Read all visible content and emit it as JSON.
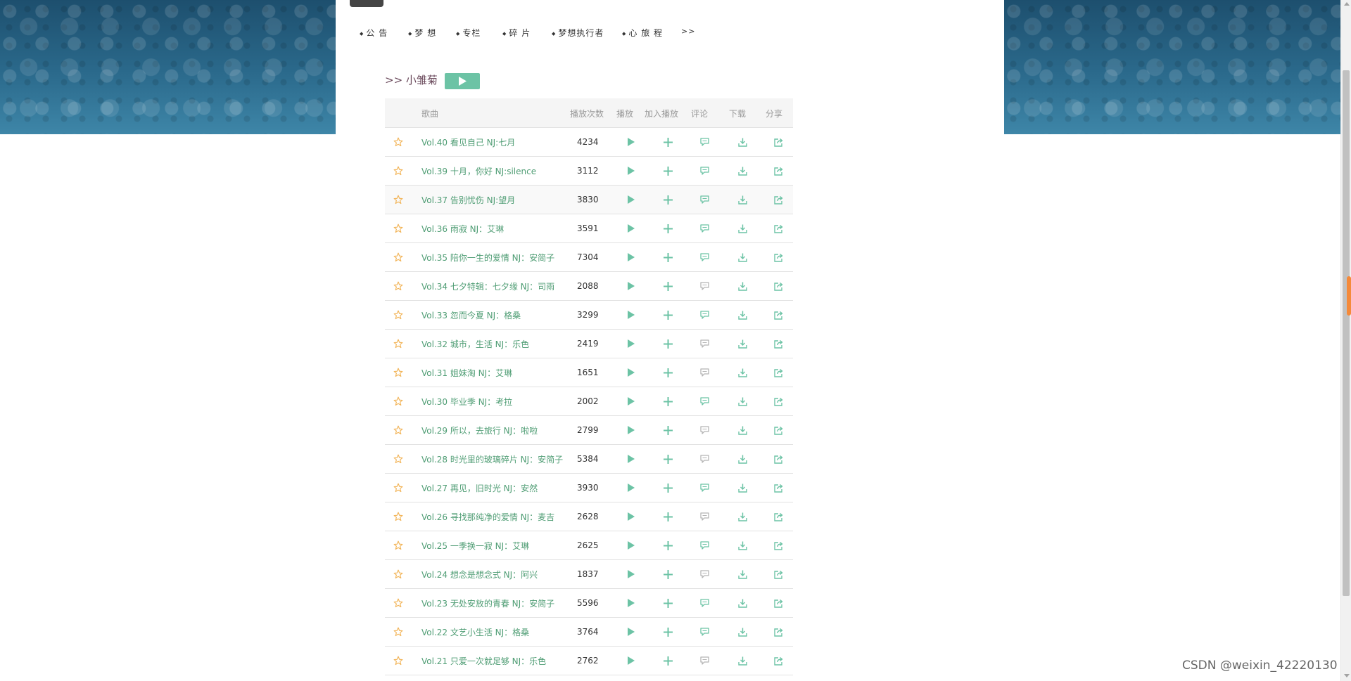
{
  "colors": {
    "accent": "#6cc3a5",
    "song_title": "#4f9d74",
    "album_title": "#6b4a5c",
    "star": "#f2b55a",
    "icon_green": "#6cc3a5",
    "icon_gray": "#b5b5b5",
    "nav_text": "#333333"
  },
  "nav": {
    "items": [
      "公 告",
      "梦 想",
      "专栏",
      "碎 片",
      "梦想执行者",
      "心 旅 程"
    ],
    "more": ">>"
  },
  "album": {
    "prefix": ">>",
    "title": "小雏菊",
    "play_icon": "play-icon"
  },
  "table": {
    "headers": {
      "song": "歌曲",
      "plays": "播放次数",
      "play": "播放",
      "add": "加入播放",
      "comment": "评论",
      "download": "下载",
      "share": "分享"
    },
    "rows": [
      {
        "title": "Vol.40 看见自己 NJ:七月",
        "plays": "4234",
        "comment_active": true
      },
      {
        "title": "Vol.39 十月，你好 NJ:silence",
        "plays": "3112",
        "comment_active": true
      },
      {
        "title": "Vol.37 告别忧伤 NJ:望月",
        "plays": "3830",
        "comment_active": true
      },
      {
        "title": "Vol.36 雨寂 NJ：艾琳",
        "plays": "3591",
        "comment_active": true
      },
      {
        "title": "Vol.35 陪你一生的爱情 NJ：安简子",
        "plays": "7304",
        "comment_active": true
      },
      {
        "title": "Vol.34 七夕特辑：七夕缘 NJ：司雨",
        "plays": "2088",
        "comment_active": false
      },
      {
        "title": "Vol.33 忽而今夏 NJ：格桑",
        "plays": "3299",
        "comment_active": true
      },
      {
        "title": "Vol.32 城市，生活 NJ：乐色",
        "plays": "2419",
        "comment_active": false
      },
      {
        "title": "Vol.31 姐妹淘 NJ：艾琳",
        "plays": "1651",
        "comment_active": false
      },
      {
        "title": "Vol.30 毕业季 NJ：考拉",
        "plays": "2002",
        "comment_active": true
      },
      {
        "title": "Vol.29 所以，去旅行 NJ：啦啦",
        "plays": "2799",
        "comment_active": false
      },
      {
        "title": "Vol.28 时光里的玻璃碎片 NJ：安简子",
        "plays": "5384",
        "comment_active": false
      },
      {
        "title": "Vol.27 再见，旧时光 NJ：安然",
        "plays": "3930",
        "comment_active": true
      },
      {
        "title": "Vol.26 寻找那纯净的爱情 NJ：麦吉",
        "plays": "2628",
        "comment_active": false
      },
      {
        "title": "Vol.25 一季换一寂 NJ：艾琳",
        "plays": "2625",
        "comment_active": true
      },
      {
        "title": "Vol.24 想念是想念式 NJ：阿兴",
        "plays": "1837",
        "comment_active": false
      },
      {
        "title": "Vol.23 无处安放的青春 NJ：安简子",
        "plays": "5596",
        "comment_active": true
      },
      {
        "title": "Vol.22 文艺小生活 NJ：格桑",
        "plays": "3764",
        "comment_active": true
      },
      {
        "title": "Vol.21 只爱一次就足够 NJ：乐色",
        "plays": "2762",
        "comment_active": false
      }
    ]
  },
  "watermark": "CSDN @weixin_42220130"
}
